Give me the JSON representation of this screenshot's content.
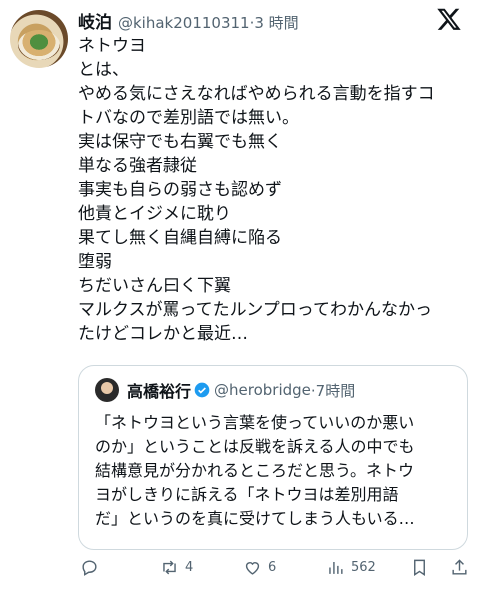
{
  "tweet": {
    "author_name": "岐泊",
    "author_handle": "@kihak20110311",
    "time": "·3 時間",
    "lines": [
      "ネトウヨ",
      "とは、",
      "やめる気にさえなればやめられる言動を指すコ",
      "トバなので差別語では無い。",
      "実は保守でも右翼でも無く",
      "単なる強者隷従",
      "事実も自らの弱さも認めず",
      "他責とイジメに耽り",
      "果てし無く自縄自縛に陥る",
      "堕弱",
      "ちだいさん曰く下翼",
      "マルクスが罵ってたルンプロってわかんなかっ",
      "たけどコレかと最近…"
    ]
  },
  "quote": {
    "author_name": "高橋裕行",
    "author_handle": "@herobridge",
    "time": "·7時間",
    "lines": [
      "「ネトウヨという言葉を使っていいのか悪い",
      "のか」ということは反戦を訴える人の中でも",
      "結構意見が分かれるところだと思う。ネトウ",
      "ヨがしきりに訴える「ネトウヨは差別用語",
      "だ」というのを真に受けてしまう人もいる…"
    ]
  },
  "actions": {
    "reply_icon": "reply-icon",
    "retweet_count": "4",
    "like_count": "6",
    "views_count": "562",
    "bookmark_icon": "bookmark-icon",
    "share_icon": "share-icon"
  },
  "colors": {
    "text": "#0f1419",
    "muted": "#536471",
    "border": "#cfd9de",
    "verified": "#1d9bf0"
  }
}
